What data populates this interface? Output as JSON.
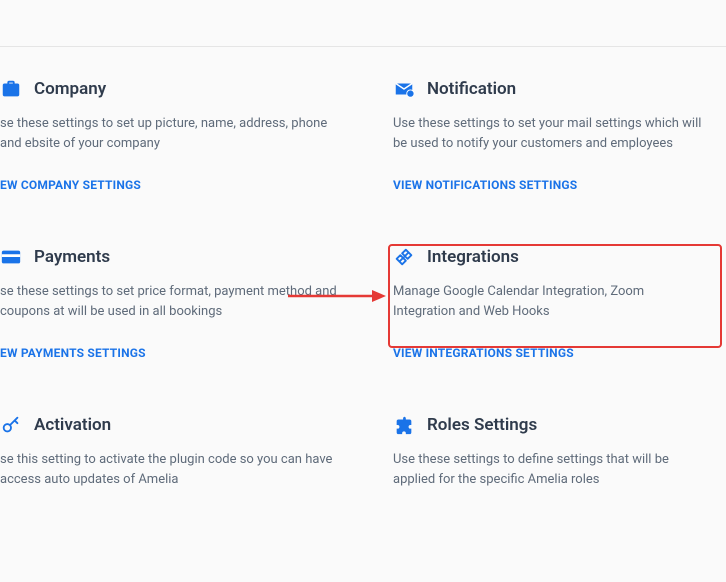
{
  "cards": {
    "company": {
      "title": "Company",
      "desc": "se these settings to set up picture, name, address, phone and ebsite of your company",
      "link": "EW COMPANY SETTINGS"
    },
    "notification": {
      "title": "Notification",
      "desc": "Use these settings to set your mail settings which will be used to notify your customers and employees",
      "link": "VIEW NOTIFICATIONS SETTINGS"
    },
    "payments": {
      "title": "Payments",
      "desc": "se these settings to set price format, payment method and coupons at will be used in all bookings",
      "link": "EW PAYMENTS SETTINGS"
    },
    "integrations": {
      "title": "Integrations",
      "desc": "Manage Google Calendar Integration, Zoom Integration and Web Hooks",
      "link": "VIEW INTEGRATIONS SETTINGS"
    },
    "activation": {
      "title": "Activation",
      "desc": "se this setting to activate the plugin code so you can have access auto updates of Amelia",
      "link": ""
    },
    "roles": {
      "title": "Roles Settings",
      "desc": "Use these settings to define settings that will be applied for the specific Amelia roles",
      "link": ""
    }
  }
}
